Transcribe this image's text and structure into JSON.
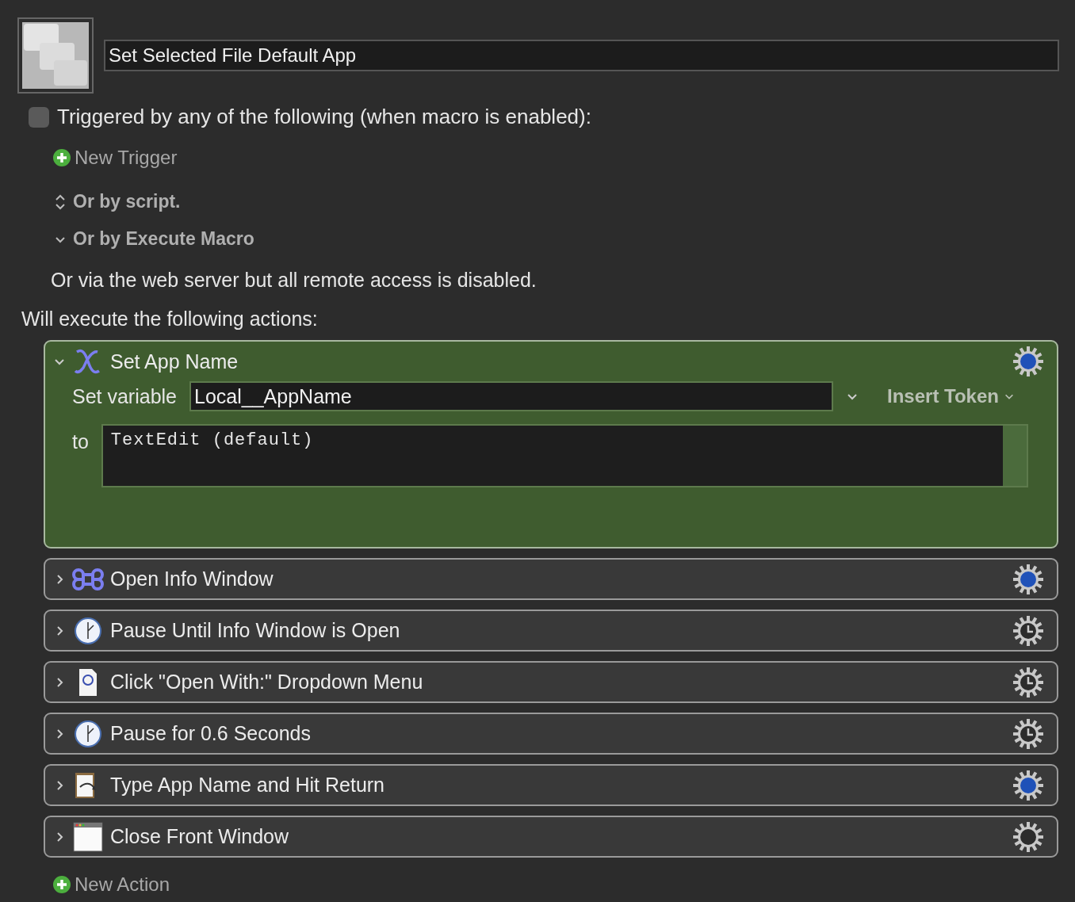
{
  "macro": {
    "name": "Set Selected File Default App"
  },
  "trigger": {
    "checked": false,
    "label": "Triggered by any of the following (when macro is enabled):"
  },
  "new_trigger": "New Trigger",
  "sections": [
    {
      "kind": "stepper",
      "label": "Or by script.",
      "expanded": false
    },
    {
      "kind": "disclosure",
      "label": "Or by Execute Macro",
      "expanded": true
    }
  ],
  "web_server_note": "Or via the web server but all remote access is disabled.",
  "actions_heading": "Will execute the following actions:",
  "actions": [
    {
      "title": "Set App Name",
      "kind": "variable",
      "dot": true,
      "clock": false,
      "expanded": true,
      "set_label": "Set variable",
      "variable": "Local__AppName",
      "insert_token": "Insert Token",
      "to_label": "to",
      "value": "TextEdit (default)"
    },
    {
      "title": "Open Info Window",
      "kind": "command",
      "dot": true,
      "clock": false,
      "expanded": false
    },
    {
      "title": "Pause Until Info Window is Open",
      "kind": "clock",
      "dot": false,
      "clock": true,
      "expanded": false
    },
    {
      "title": "Click \"Open With:\" Dropdown Menu",
      "kind": "document",
      "dot": false,
      "clock": true,
      "expanded": false
    },
    {
      "title": "Pause for 0.6 Seconds",
      "kind": "clock",
      "dot": false,
      "clock": true,
      "expanded": false
    },
    {
      "title": "Type App Name and Hit Return",
      "kind": "clipboard",
      "dot": true,
      "clock": false,
      "expanded": false
    },
    {
      "title": "Close Front Window",
      "kind": "window",
      "dot": false,
      "clock": false,
      "expanded": false
    }
  ],
  "new_action": "New Action"
}
